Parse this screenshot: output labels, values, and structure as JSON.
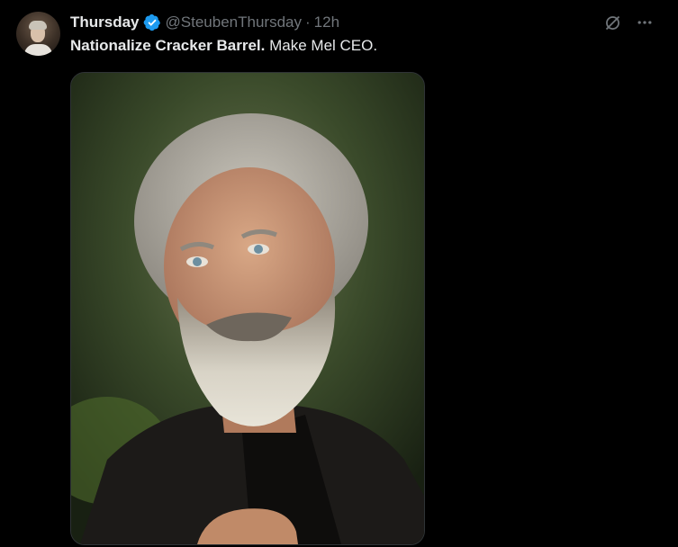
{
  "tweet": {
    "display_name": "Thursday",
    "handle": "@SteubenThursday",
    "separator": "·",
    "time": "12h",
    "text_bold": "Nationalize Cracker Barrel.",
    "text_rest": " Make Mel CEO."
  },
  "icons": {
    "verified": "verified-badge-icon",
    "grok": "grok-icon",
    "more": "more-icon"
  },
  "colors": {
    "background": "#000000",
    "text": "#e7e9ea",
    "secondary": "#71767b",
    "verified": "#1d9bf0"
  }
}
